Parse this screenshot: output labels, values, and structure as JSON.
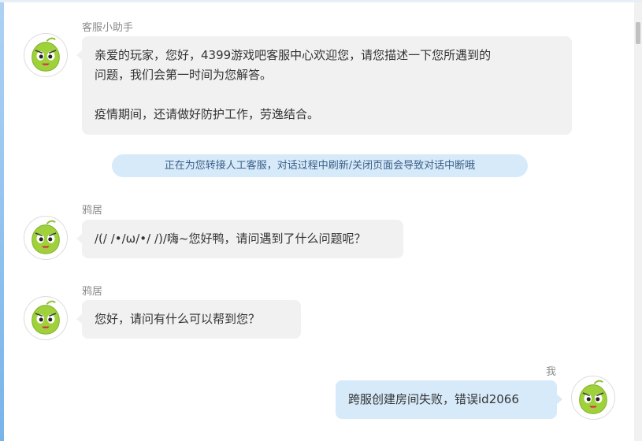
{
  "messages": [
    {
      "sender": "客服小助手",
      "lines": [
        "亲爱的玩家，您好，4399游戏吧客服中心欢迎您，请您描述一下您所遇到的",
        "问题，我们会第一时间为您解答。",
        "疫情期间，还请做好防护工作，劳逸结合。"
      ]
    },
    {
      "notice": "正在为您转接人工客服，对话过程中刷新/关闭页面会导致对话中断哦"
    },
    {
      "sender": "鸦居",
      "text": "/(/ /•/ω/•/ /)/嗨~您好鸭，请问遇到了什么问题呢？"
    },
    {
      "sender": "鸦居",
      "text": "您好，请问有什么可以帮到您？"
    },
    {
      "sender": "我",
      "text": "跨服创建房间失败，错误id2066"
    }
  ],
  "avatar_icon": "green-blob-mascot-icon",
  "colors": {
    "agent_bubble": "#f1f1f1",
    "user_bubble": "#d7eafa",
    "notice_bg": "#d7eafa",
    "notice_text": "#3a5e86",
    "mascot_green": "#9fd13b"
  }
}
